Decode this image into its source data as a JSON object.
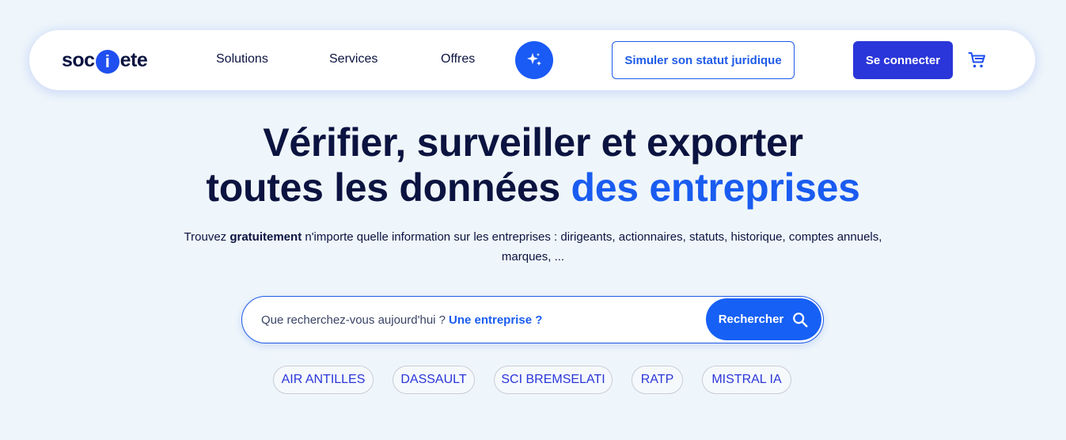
{
  "header": {
    "logo": {
      "part1": "soc",
      "dot": "i",
      "part2": "ete"
    },
    "nav": [
      {
        "label": "Solutions"
      },
      {
        "label": "Services"
      },
      {
        "label": "Offres"
      }
    ],
    "ai_icon": "sparkles-icon",
    "simulate_label": "Simuler son statut juridique",
    "login_label": "Se connecter",
    "cart_icon": "cart-icon"
  },
  "hero": {
    "title_line1": "Vérifier, surveiller et exporter",
    "title_line2_part1": "toutes les données ",
    "title_line2_accent": "des entreprises",
    "subtitle_part1": "Trouvez ",
    "subtitle_bold": "gratuitement",
    "subtitle_part2": " n'importe quelle information sur les entreprises : dirigeants, actionnaires, statuts, historique, comptes annuels, marques, ..."
  },
  "search": {
    "placeholder": "Que recherchez-vous aujourd'hui ?",
    "hint": "Une entreprise ?",
    "button_label": "Rechercher",
    "button_icon": "search-icon"
  },
  "suggestions": [
    {
      "label": "AIR ANTILLES"
    },
    {
      "label": "DASSAULT"
    },
    {
      "label": "SCI BREMSELATI"
    },
    {
      "label": "RATP"
    },
    {
      "label": "MISTRAL IA"
    }
  ],
  "colors": {
    "background": "#eff6fb",
    "navy": "#0b1340",
    "accent_blue": "#1a5cf0",
    "login_blue": "#2a36d9"
  }
}
